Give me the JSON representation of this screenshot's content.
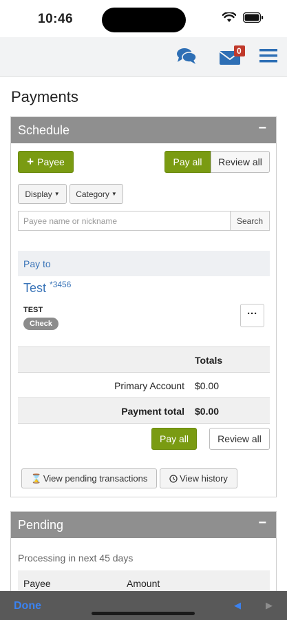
{
  "status_bar": {
    "time": "10:46"
  },
  "header": {
    "notification_count": "0"
  },
  "page": {
    "title": "Payments"
  },
  "schedule": {
    "title": "Schedule",
    "toggle": "−",
    "add_payee_label": "Payee",
    "pay_all_label": "Pay all",
    "review_all_label": "Review all",
    "display_label": "Display",
    "category_label": "Category",
    "search_placeholder": "Payee name or nickname",
    "search_button": "Search",
    "pay_to_header": "Pay to",
    "payee": {
      "name": "Test",
      "account": "*3456",
      "nickname": "TEST",
      "method": "Check",
      "more": "···"
    },
    "totals_header": "Totals",
    "rows": [
      {
        "label": "Primary Account",
        "value": "$0.00"
      },
      {
        "label": "Payment total",
        "value": "$0.00"
      }
    ],
    "pay_all_bottom": "Pay all",
    "review_all_bottom": "Review all",
    "view_pending_label": "View pending transactions",
    "view_history_label": "View history"
  },
  "pending": {
    "title": "Pending",
    "toggle": "−",
    "subtitle": "Processing in next 45 days",
    "columns": [
      "Payee",
      "Amount"
    ]
  },
  "bottom_bar": {
    "done": "Done",
    "prev": "◀",
    "next": "▶"
  },
  "colors": {
    "accent_green": "#7a9b12",
    "link_blue": "#3a74b8",
    "header_grey": "#8f8f8f"
  }
}
